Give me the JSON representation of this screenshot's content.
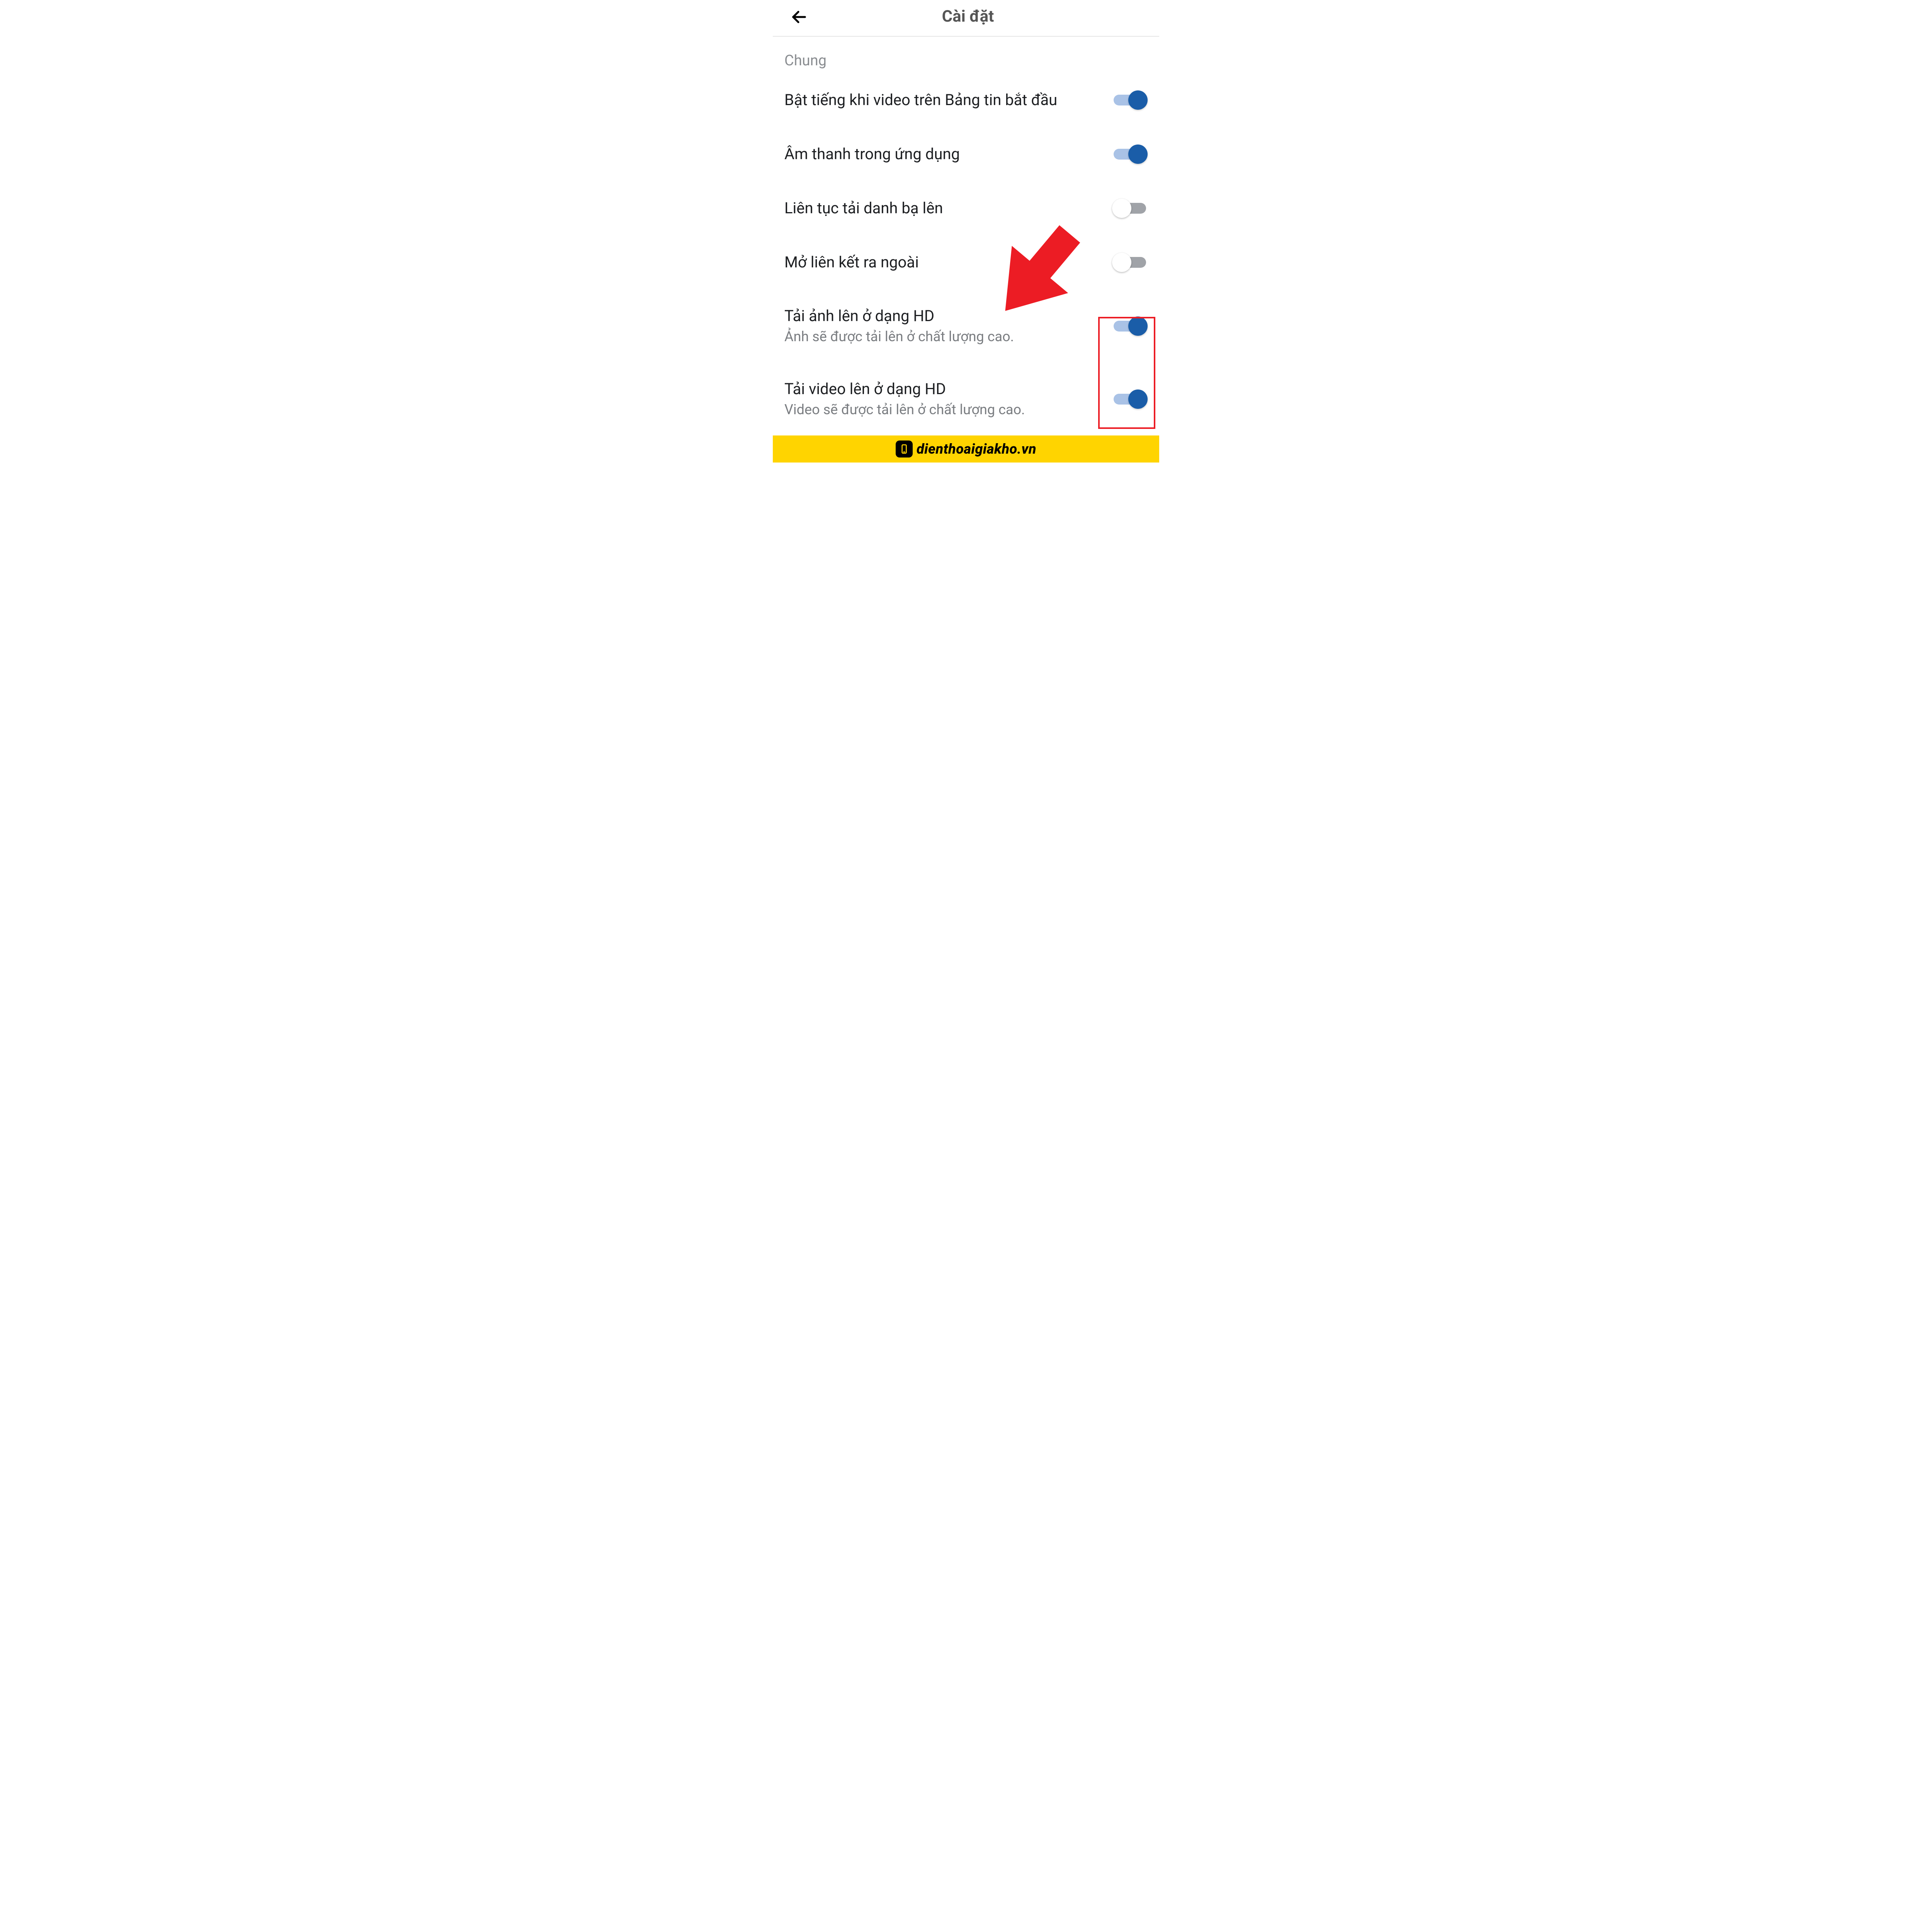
{
  "header": {
    "title": "Cài đặt"
  },
  "section": {
    "label": "Chung"
  },
  "colors": {
    "accent_on": "#1a5da8",
    "accent_track": "#a9c2e6",
    "off_track": "#a0a3a8",
    "highlight": "#ec1c24",
    "footer_bg": "#ffd400"
  },
  "settings": [
    {
      "key": "sound-newsfeed-video",
      "label": "Bật tiếng khi video trên Bảng tin bắt đầu",
      "sub": "",
      "on": true
    },
    {
      "key": "in-app-sound",
      "label": "Âm thanh trong ứng dụng",
      "sub": "",
      "on": true
    },
    {
      "key": "continuous-contacts",
      "label": "Liên tục tải danh bạ lên",
      "sub": "",
      "on": false
    },
    {
      "key": "open-links-external",
      "label": "Mở liên kết ra ngoài",
      "sub": "",
      "on": false
    },
    {
      "key": "upload-photos-hd",
      "label": "Tải ảnh lên ở dạng HD",
      "sub": "Ảnh sẽ được tải lên ở chất lượng cao.",
      "on": true
    },
    {
      "key": "upload-videos-hd",
      "label": "Tải video lên ở dạng HD",
      "sub": "Video sẽ được tải lên ở chất lượng cao.",
      "on": true
    }
  ],
  "footer": {
    "site": "dienthoaigiakho.vn"
  }
}
